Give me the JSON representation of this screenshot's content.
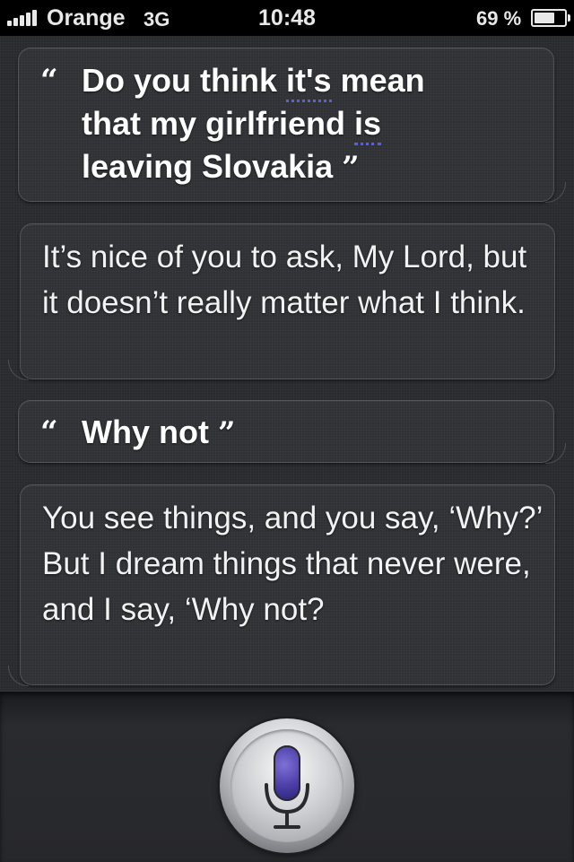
{
  "status_bar": {
    "carrier": "Orange",
    "network": "3G",
    "time": "10:48",
    "battery_percent": "69 %",
    "battery_level": 0.69
  },
  "conversation": {
    "user_query_1": {
      "quote_open": "“",
      "quote_close": "”",
      "line1_a": "Do you think ",
      "line1_b": "it's",
      "line1_c": " mean",
      "line2_a": "that my girlfriend ",
      "line2_b": "is",
      "line3": "leaving Slovakia "
    },
    "siri_response_1": "It’s nice of you to ask, My Lord, but it doesn’t really matter what I think.",
    "user_query_2": {
      "quote_open": "“",
      "quote_close": "”",
      "text": "Why not "
    },
    "siri_response_2": "You see things, and you say, ‘Why?’ But I dream things that never were, and I say, ‘Why not?"
  },
  "mic": {
    "icon": "microphone-icon",
    "accent": "#5a4bc2"
  }
}
